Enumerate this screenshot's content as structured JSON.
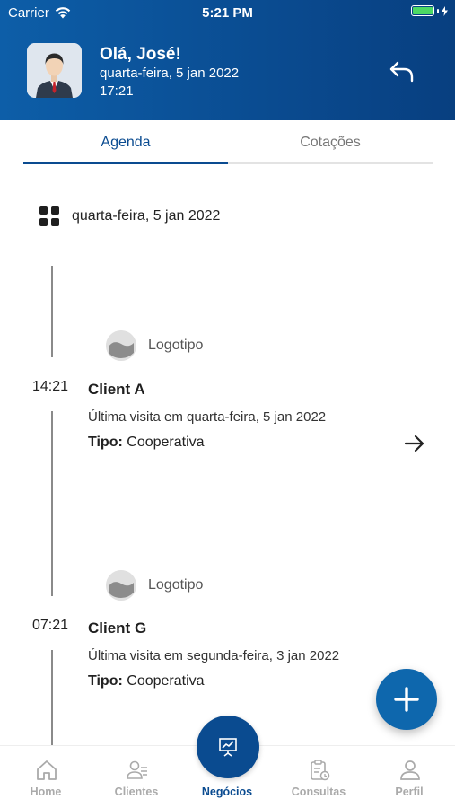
{
  "status_bar": {
    "carrier": "Carrier",
    "time": "5:21 PM",
    "battery_color": "#4cd964"
  },
  "header": {
    "greeting": "Olá, José!",
    "date": "quarta-feira, 5 jan 2022",
    "time": "17:21",
    "back_icon": "undo-arrow-icon",
    "background": "#0a4b90"
  },
  "tabs": [
    {
      "label": "Agenda",
      "active": true
    },
    {
      "label": "Cotações",
      "active": false
    }
  ],
  "agenda": {
    "date_label": "quarta-feira, 5 jan 2022",
    "items": [
      {
        "logo_label": "Logotipo",
        "time": "14:21",
        "client": "Client A",
        "last_visit": "Última visita em quarta-feira, 5 jan 2022",
        "tipo_label": "Tipo:",
        "tipo_value": "Cooperativa",
        "has_arrow": true
      },
      {
        "logo_label": "Logotipo",
        "time": "07:21",
        "client": "Client G",
        "last_visit": "Última visita em segunda-feira, 3 jan 2022",
        "tipo_label": "Tipo:",
        "tipo_value": "Cooperativa",
        "has_arrow": false
      }
    ]
  },
  "fab": {
    "icon": "plus-icon",
    "color": "#0e67ad"
  },
  "bottom_nav": [
    {
      "label": "Home",
      "icon": "home-icon",
      "active": false
    },
    {
      "label": "Clientes",
      "icon": "users-icon",
      "active": false
    },
    {
      "label": "Negócios",
      "icon": "presentation-chart-icon",
      "active": true
    },
    {
      "label": "Consultas",
      "icon": "clipboard-clock-icon",
      "active": false
    },
    {
      "label": "Perfil",
      "icon": "person-icon",
      "active": false
    }
  ],
  "colors": {
    "primary": "#0a4b90",
    "inactive_nav": "#aaaaaa"
  }
}
